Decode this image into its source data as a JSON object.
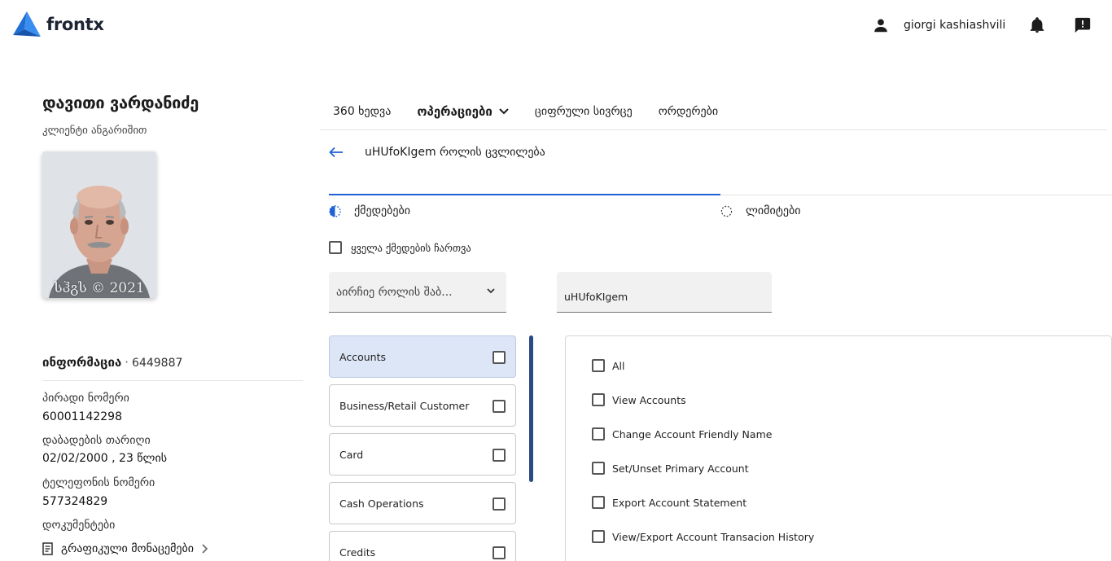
{
  "header": {
    "brand": "frontx",
    "user_name": "giorgi kashiashvili",
    "icons": [
      "person-icon",
      "bell-icon",
      "feedback-icon"
    ]
  },
  "client": {
    "name": "დავითი ვარდანიძე",
    "subtitle": "კლიენტი ანგარიშით",
    "photo_watermark": "სჰგს © 2021"
  },
  "info": {
    "title": "ინფორმაცია",
    "separator": "·",
    "number": "6449887",
    "personal_number_label": "პირადი ნომერი",
    "personal_number": "60001142298",
    "birthdate_label": "დაბადების თარიღი",
    "birthdate": "02/02/2000 , 23 წლის",
    "phone_label": "ტელეფონის ნომერი",
    "phone": "577324829",
    "documents_label": "დოკუმენტები",
    "graph_data_link": "გრაფიკული მონაცემები"
  },
  "nav": {
    "tabs": [
      {
        "label": "360 ხედვა"
      },
      {
        "label": "ოპერაციები"
      },
      {
        "label": "ციფრული სივრცე"
      },
      {
        "label": "ორდერები"
      }
    ],
    "active_tab": "ოპერაციები"
  },
  "page": {
    "title": "uHUfoKIgem როლის ცვლილება"
  },
  "steps": {
    "active": "ქმედებები",
    "next": "ლიმიტები"
  },
  "form": {
    "select_all_label": "ყველა ქმედების ჩართვა",
    "role_template_placeholder": "აირჩიე როლის შაბ...",
    "role_name_value": "uHUfoKIgem"
  },
  "categories": [
    {
      "label": "Accounts",
      "active": true
    },
    {
      "label": "Business/Retail Customer",
      "active": false
    },
    {
      "label": "Card",
      "active": false
    },
    {
      "label": "Cash Operations",
      "active": false
    },
    {
      "label": "Credits",
      "active": false
    }
  ],
  "permissions": [
    {
      "label": "All"
    },
    {
      "label": "View Accounts"
    },
    {
      "label": "Change Account Friendly Name"
    },
    {
      "label": "Set/Unset Primary Account"
    },
    {
      "label": "Export Account Statement"
    },
    {
      "label": "View/Export Account Transacion History"
    }
  ],
  "colors": {
    "accent": "#1e62d6",
    "active_category_bg": "#dde6f6",
    "scrollbar": "#2a4a85",
    "input_bg": "#f1f1f1"
  }
}
